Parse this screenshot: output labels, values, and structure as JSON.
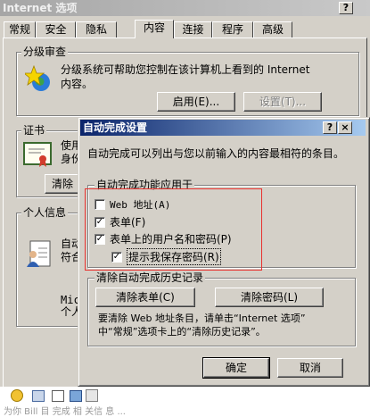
{
  "bg_window": {
    "title": "Internet 选项",
    "help_glyph": "?",
    "tabs": [
      "常规",
      "安全",
      "隐私",
      "内容",
      "连接",
      "程序",
      "高级"
    ],
    "active_tab": "内容",
    "content_advisor": {
      "group_label": "分级审查",
      "description_line1": "分级系统可帮助您控制在该计算机上看到的 Internet",
      "description_line2": "内容。",
      "enable_button": "启用(E)...",
      "settings_button": "设置(T)..."
    },
    "certificates": {
      "group_label": "证书",
      "text_line1": "使用",
      "text_line2": "身份",
      "clear_button": "清除"
    },
    "personal_info": {
      "group_label": "个人信息",
      "text_line1": "自动",
      "text_line2": "符合",
      "text_line3": "Mic",
      "text_line4": "个人"
    },
    "bottom_partial_text": "为你 Bill 目 完成 相 关信 息 ..."
  },
  "dialog": {
    "title": "自动完成设置",
    "help_glyph": "?",
    "close_glyph": "×",
    "description": "自动完成可以列出与您以前输入的内容最相符的条目。",
    "apply_group": {
      "label": "自动完成功能应用于",
      "options": [
        {
          "label": "Web 地址(A)",
          "checked": false
        },
        {
          "label": "表单(F)",
          "checked": true
        },
        {
          "label": "表单上的用户名和密码(P)",
          "checked": true
        },
        {
          "label": "提示我保存密码(R)",
          "checked": true
        }
      ]
    },
    "history_group": {
      "label": "清除自动完成历史记录",
      "clear_forms_button": "清除表单(C)",
      "clear_passwords_button": "清除密码(L)",
      "note_line1": "要清除 Web 地址条目，请单击“Internet 选项”",
      "note_line2": "中“常规”选项卡上的“清除历史记录”。"
    },
    "ok_button": "确定",
    "cancel_button": "取消"
  }
}
